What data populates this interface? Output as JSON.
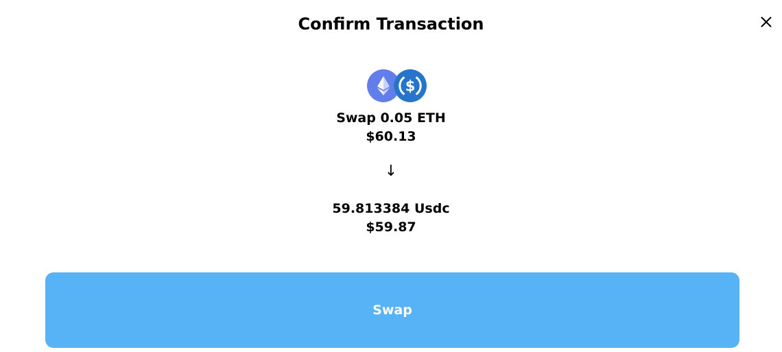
{
  "dialog": {
    "title": "Confirm Transaction",
    "close_icon": "close-icon"
  },
  "from": {
    "token_icon": "eth-icon",
    "label": "Swap 0.05 ETH",
    "usd_value": "$60.13"
  },
  "direction_icon": "arrow-down-icon",
  "direction_glyph": "↓",
  "to": {
    "token_icon": "usdc-icon",
    "label": "59.813384 Usdc",
    "usd_value": "$59.87"
  },
  "actions": {
    "swap_label": "Swap"
  },
  "colors": {
    "eth": "#627eea",
    "usdc": "#2775ca",
    "button": "#58b2f6",
    "button_text": "#ffffff"
  }
}
